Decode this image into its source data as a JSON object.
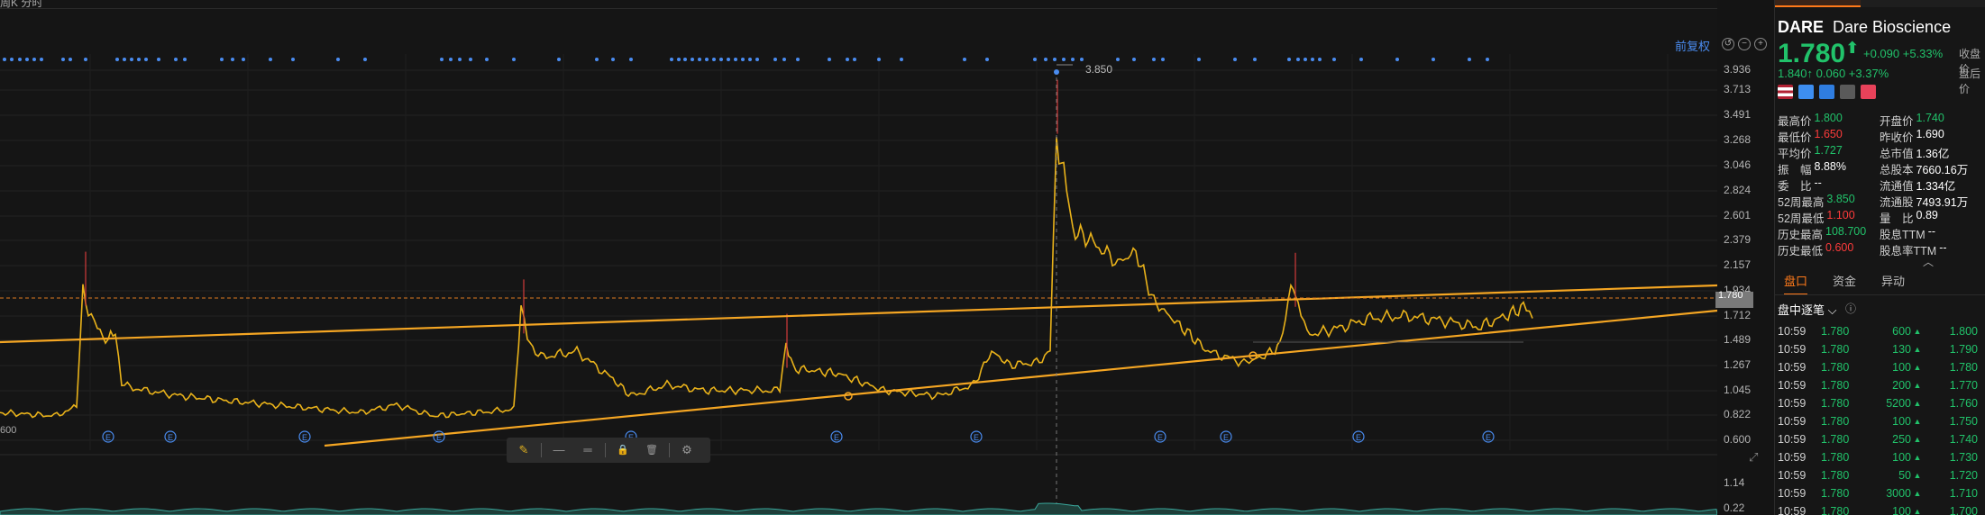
{
  "header": {
    "title_fragment": "周K  分时"
  },
  "chart": {
    "fq_label": "前复权",
    "peak_label": "3.850",
    "left_axis_label": "600",
    "current_price_tag": "1.780",
    "y_ticks": [
      "3.936",
      "3.713",
      "3.491",
      "3.268",
      "3.046",
      "2.824",
      "2.601",
      "2.379",
      "2.157",
      "1.934",
      "1.712",
      "1.489",
      "1.267",
      "1.045",
      "0.822",
      "0.600"
    ],
    "sub_ticks": [
      "1.14",
      "0.22"
    ],
    "event_marker": "E"
  },
  "drawing_toolbar": {
    "pen_icon": "✎",
    "line_icon": "—",
    "line2_icon": "═",
    "lock_icon": "🔒",
    "trash_icon": "🗑",
    "gear_icon": "⚙"
  },
  "quote": {
    "ticker": "DARE",
    "name": "Dare Bioscience",
    "price": "1.780",
    "arrow": "⬆",
    "change": "+0.090",
    "change_pct": "+5.33%",
    "afterhours": "1.840↑  0.060  +3.37%",
    "side_label_1": "收盘价",
    "side_label_2": "盘后价",
    "colors": {
      "up": "#21c26a",
      "down": "#ff3b3b",
      "accent": "#ff7a1a"
    }
  },
  "stats": [
    [
      [
        "最高价",
        "1.800",
        "g"
      ],
      [
        "开盘价",
        "1.740",
        "g"
      ]
    ],
    [
      [
        "最低价",
        "1.650",
        "r"
      ],
      [
        "昨收价",
        "1.690",
        "w"
      ]
    ],
    [
      [
        "平均价",
        "1.727",
        "g"
      ],
      [
        "总市值",
        "1.36亿",
        "w"
      ]
    ],
    [
      [
        "振　幅",
        "8.88%",
        "w"
      ],
      [
        "总股本",
        "7660.16万",
        "w"
      ]
    ],
    [
      [
        "委　比",
        "--",
        "w"
      ],
      [
        "流通值",
        "1.334亿",
        "w"
      ]
    ],
    [
      [
        "52周最高",
        "3.850",
        "g"
      ],
      [
        "流通股",
        "7493.91万",
        "w"
      ]
    ],
    [
      [
        "52周最低",
        "1.100",
        "r"
      ],
      [
        "量　比",
        "0.89",
        "w"
      ]
    ],
    [
      [
        "历史最高",
        "108.700",
        "g"
      ],
      [
        "股息TTM",
        "--",
        "w"
      ]
    ],
    [
      [
        "历史最低",
        "0.600",
        "r"
      ],
      [
        "股息率TTM",
        "--",
        "w"
      ]
    ]
  ],
  "tabs": [
    "盘口",
    "资金",
    "异动"
  ],
  "tick_title": "盘中逐笔",
  "ticks": [
    [
      "10:59",
      "1.780",
      "600",
      "1.800"
    ],
    [
      "10:59",
      "1.780",
      "130",
      "1.790"
    ],
    [
      "10:59",
      "1.780",
      "100",
      "1.780"
    ],
    [
      "10:59",
      "1.780",
      "200",
      "1.770"
    ],
    [
      "10:59",
      "1.780",
      "5200",
      "1.760"
    ],
    [
      "10:59",
      "1.780",
      "100",
      "1.750"
    ],
    [
      "10:59",
      "1.780",
      "250",
      "1.740"
    ],
    [
      "10:59",
      "1.780",
      "100",
      "1.730"
    ],
    [
      "10:59",
      "1.780",
      "50",
      "1.720"
    ],
    [
      "10:59",
      "1.780",
      "3000",
      "1.710"
    ],
    [
      "10:59",
      "1.780",
      "100",
      "1.700"
    ]
  ]
}
